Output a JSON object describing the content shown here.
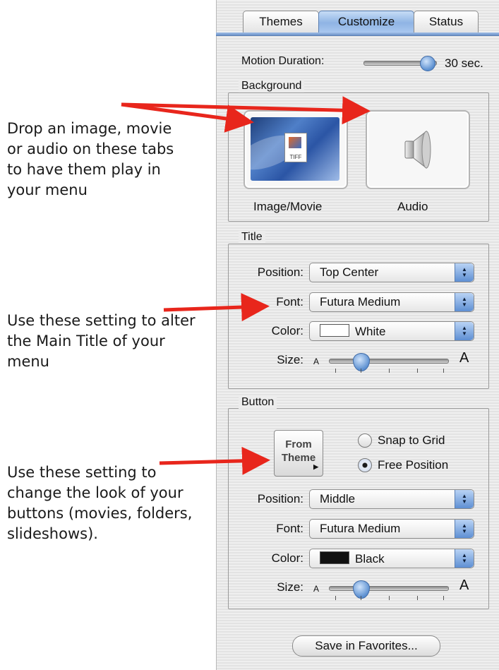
{
  "annotations": {
    "background_note": "Drop an image, movie\nor audio on these tabs\nto have them play in\nyour menu",
    "title_note": "Use these setting to alter\nthe Main Title of your\nmenu",
    "button_note": "Use these setting to\nchange the look of your\nbuttons (movies, folders,\nslideshows)."
  },
  "tabs": [
    {
      "label": "Themes",
      "selected": false
    },
    {
      "label": "Customize",
      "selected": true
    },
    {
      "label": "Status",
      "selected": false
    }
  ],
  "motion": {
    "label": "Motion Duration:",
    "value": "30 sec."
  },
  "background": {
    "legend": "Background",
    "image_label": "Image/Movie",
    "image_badge": "TIFF",
    "audio_label": "Audio"
  },
  "title": {
    "legend": "Title",
    "position_label": "Position:",
    "position_value": "Top Center",
    "font_label": "Font:",
    "font_value": "Futura Medium",
    "color_label": "Color:",
    "color_value": "White",
    "color_swatch": "#ffffff",
    "size_label": "Size:",
    "size_small": "A",
    "size_large": "A"
  },
  "button": {
    "legend": "Button",
    "from_theme_line1": "From",
    "from_theme_line2": "Theme",
    "snap_label": "Snap to Grid",
    "snap_selected": false,
    "free_label": "Free Position",
    "free_selected": true,
    "position_label": "Position:",
    "position_value": "Middle",
    "font_label": "Font:",
    "font_value": "Futura Medium",
    "color_label": "Color:",
    "color_value": "Black",
    "color_swatch": "#111111",
    "size_label": "Size:",
    "size_small": "A",
    "size_large": "A"
  },
  "save_button": "Save in Favorites...",
  "colors": {
    "arrow": "#e8261c",
    "accent": "#5e8fd3"
  }
}
